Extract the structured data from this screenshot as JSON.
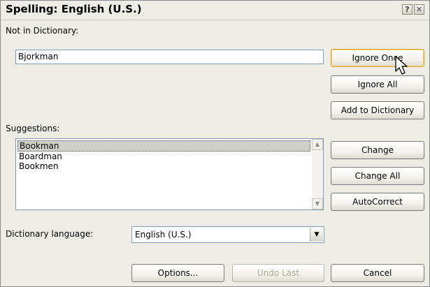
{
  "window": {
    "title": "Spelling: English (U.S.)",
    "help_icon": "?",
    "close_icon": "✕"
  },
  "not_in_dictionary": {
    "label": "Not in Dictionary:",
    "value": "Bjorkman"
  },
  "suggestions": {
    "label": "Suggestions:",
    "items": [
      "Bookman",
      "Boardman",
      "Bookmen"
    ],
    "selected_index": 0
  },
  "dictionary_language": {
    "label": "Dictionary language:",
    "value": "English (U.S.)"
  },
  "buttons": {
    "ignore_once": "Ignore Once",
    "ignore_all": "Ignore All",
    "add_to_dictionary": "Add to Dictionary",
    "change": "Change",
    "change_all": "Change All",
    "autocorrect": "AutoCorrect",
    "options": "Options...",
    "undo_last": "Undo Last",
    "cancel": "Cancel"
  },
  "icons": {
    "scroll_up": "▲",
    "scroll_down": "▼",
    "dropdown": "▼",
    "cursor": "arrow-pointer-icon"
  }
}
